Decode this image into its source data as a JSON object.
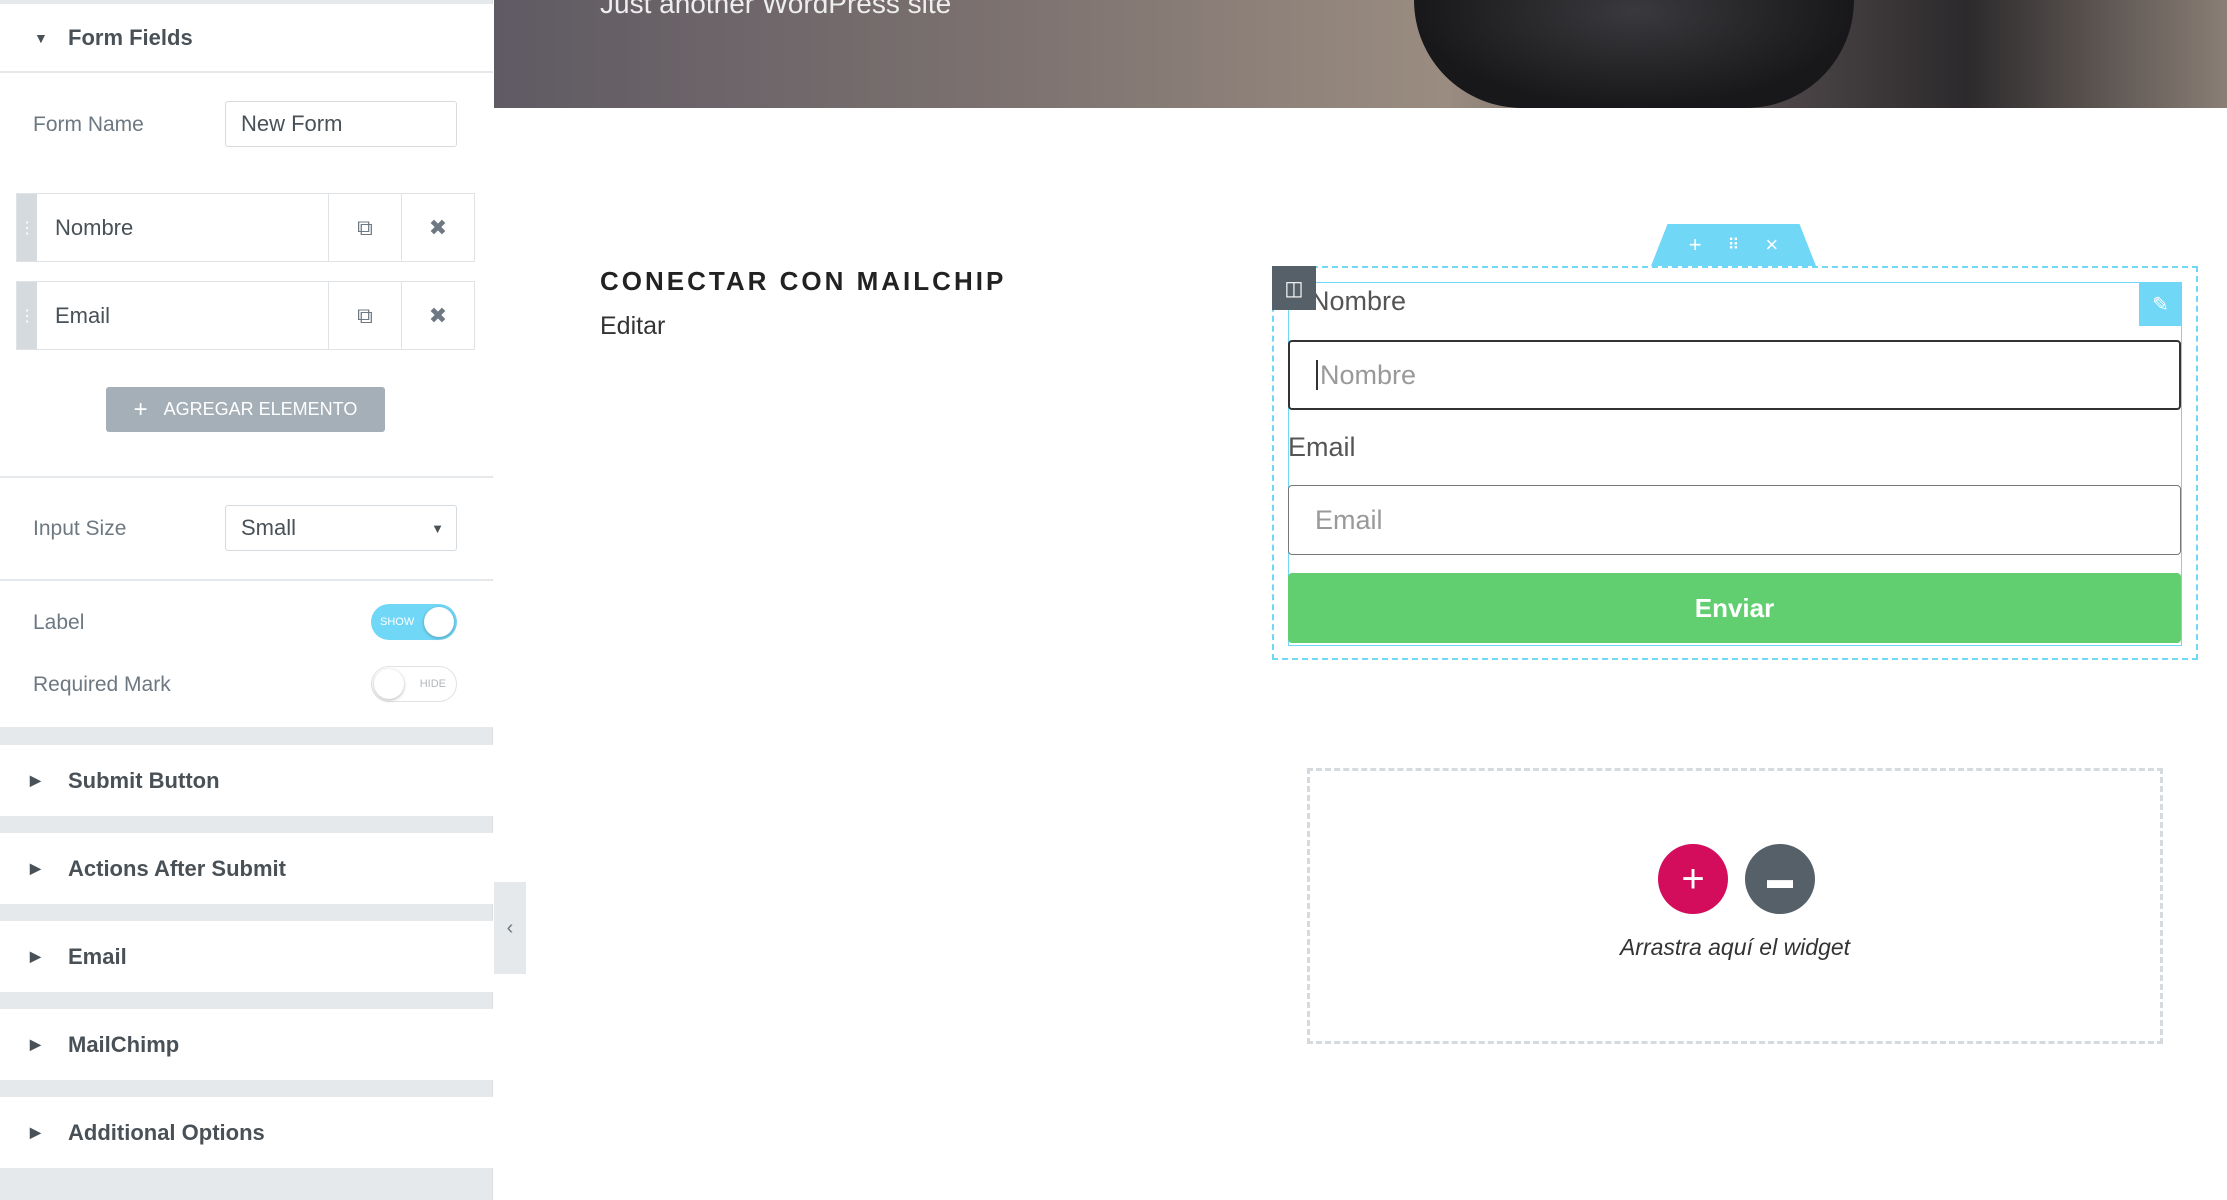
{
  "sidebar": {
    "form_fields": {
      "title": "Form Fields",
      "form_name_label": "Form Name",
      "form_name_value": "New Form",
      "fields": [
        {
          "label": "Nombre"
        },
        {
          "label": "Email"
        }
      ],
      "add_button": "AGREGAR ELEMENTO"
    },
    "input_size": {
      "label": "Input Size",
      "value": "Small"
    },
    "label_toggle": {
      "label": "Label",
      "state": "SHOW",
      "on": true
    },
    "required_toggle": {
      "label": "Required Mark",
      "state": "HIDE",
      "on": false
    },
    "sections": [
      {
        "title": "Submit Button"
      },
      {
        "title": "Actions After Submit"
      },
      {
        "title": "Email"
      },
      {
        "title": "MailChimp"
      },
      {
        "title": "Additional Options"
      }
    ]
  },
  "canvas": {
    "site_tagline": "Just another WordPress site",
    "heading": "CONECTAR CON MAILCHIP",
    "subtext": "Editar",
    "form": {
      "name_label": "Nombre",
      "name_placeholder": "Nombre",
      "email_label": "Email",
      "email_placeholder": "Email",
      "submit": "Enviar"
    },
    "dropzone_text": "Arrastra aquí el widget"
  },
  "colors": {
    "accent": "#71d7f7",
    "submit": "#61ce70",
    "add": "#d30c5c"
  }
}
